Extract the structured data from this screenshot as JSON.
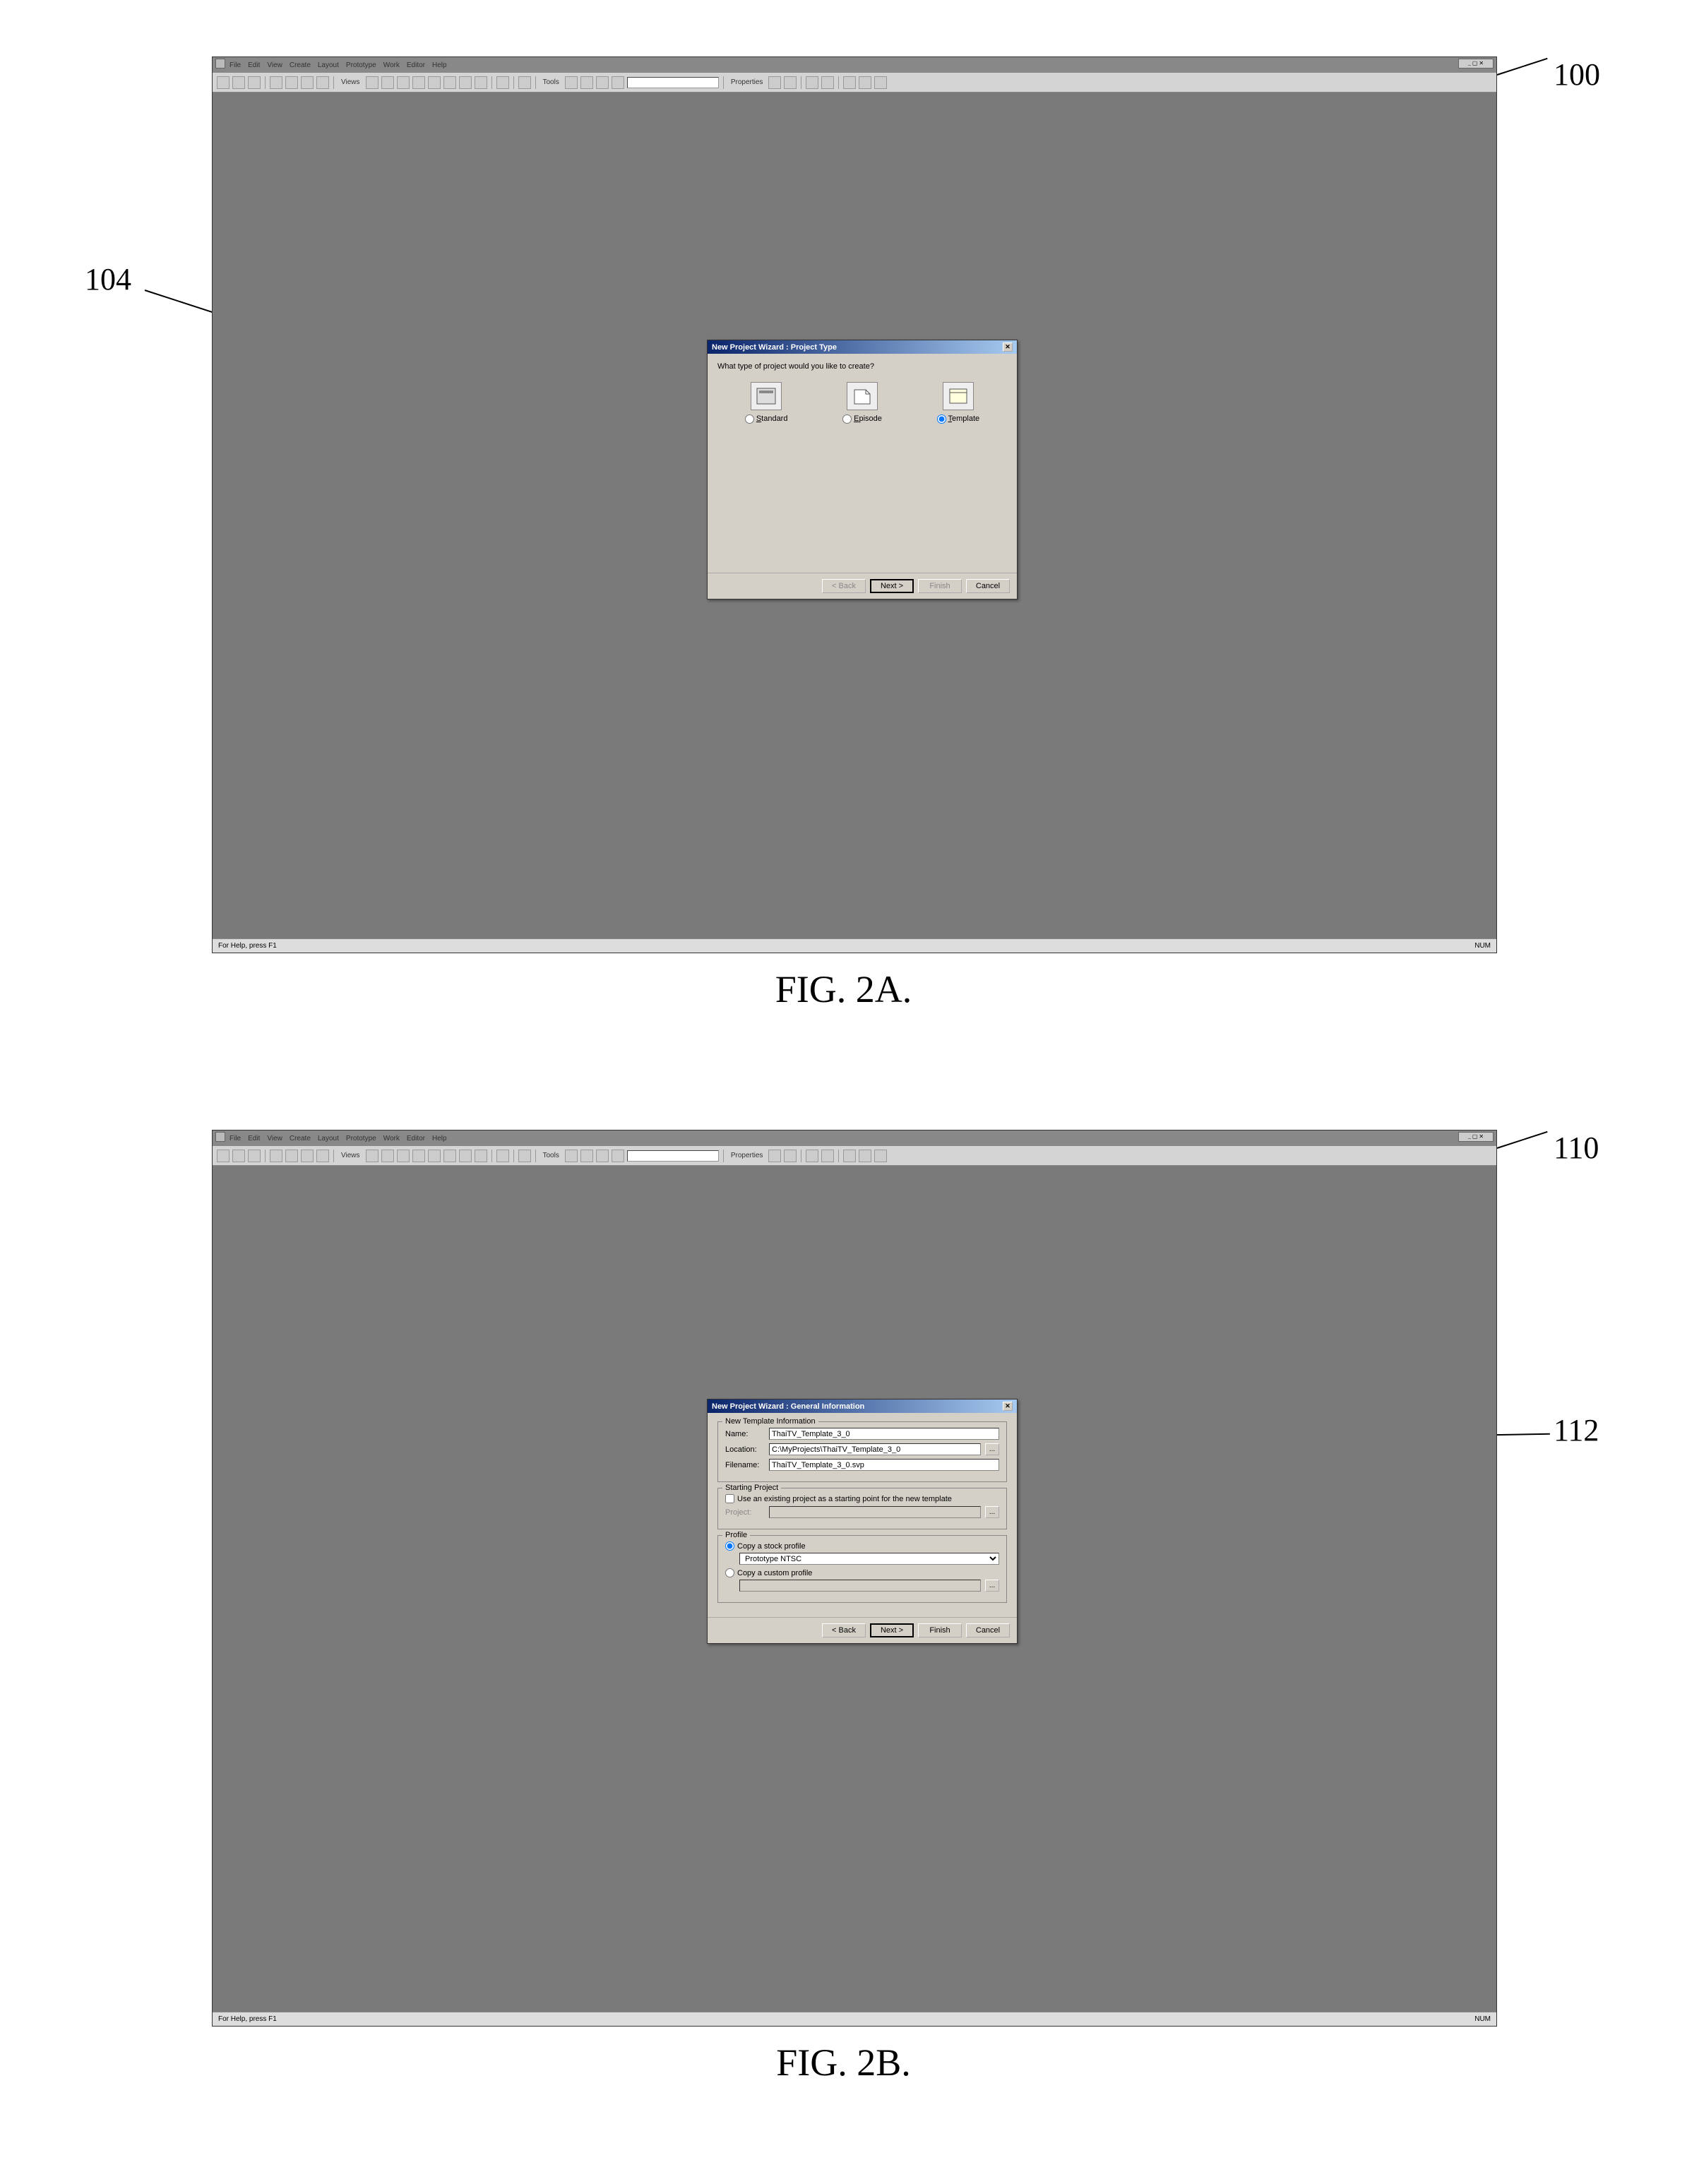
{
  "figA": {
    "caption": "FIG. 2A.",
    "callouts": {
      "c100": "100",
      "c104": "104"
    },
    "app": {
      "menu": [
        "File",
        "Edit",
        "View",
        "Create",
        "Layout",
        "Prototype",
        "Work",
        "Editor",
        "Help"
      ],
      "toolbar": {
        "views_label": "Views",
        "tools_label": "Tools",
        "properties_label": "Properties"
      },
      "status_left": "For Help, press F1",
      "status_right": "NUM"
    },
    "dialog": {
      "title": "New Project Wizard : Project Type",
      "prompt": "What type of project would you like to create?",
      "options": {
        "standard": "Standard",
        "episode": "Episode",
        "template": "Template"
      },
      "buttons": {
        "back": "< Back",
        "next": "Next >",
        "finish": "Finish",
        "cancel": "Cancel"
      }
    }
  },
  "figB": {
    "caption": "FIG. 2B.",
    "callouts": {
      "c110": "110",
      "c112": "112"
    },
    "app": {
      "menu": [
        "File",
        "Edit",
        "View",
        "Create",
        "Layout",
        "Prototype",
        "Work",
        "Editor",
        "Help"
      ],
      "toolbar": {
        "views_label": "Views",
        "tools_label": "Tools",
        "properties_label": "Properties"
      },
      "status_left": "For Help, press F1",
      "status_right": "NUM"
    },
    "dialog": {
      "title": "New Project Wizard : General Information",
      "group_template": "New Template Information",
      "labels": {
        "name": "Name:",
        "location": "Location:",
        "filename": "Filename:",
        "project": "Project:"
      },
      "fields": {
        "name": "ThaiTV_Template_3_0",
        "location": "C:\\MyProjects\\ThaiTV_Template_3_0",
        "filename": "ThaiTV_Template_3_0.svp",
        "project": ""
      },
      "group_starting": "Starting Project",
      "checkbox_use_existing": "Use an existing project as a starting point for the new template",
      "group_profile": "Profile",
      "radio_stock": "Copy a stock profile",
      "combo_stock": "Prototype NTSC",
      "radio_custom": "Copy a custom profile",
      "custom_value": "",
      "buttons": {
        "back": "< Back",
        "next": "Next >",
        "finish": "Finish",
        "cancel": "Cancel"
      }
    }
  }
}
